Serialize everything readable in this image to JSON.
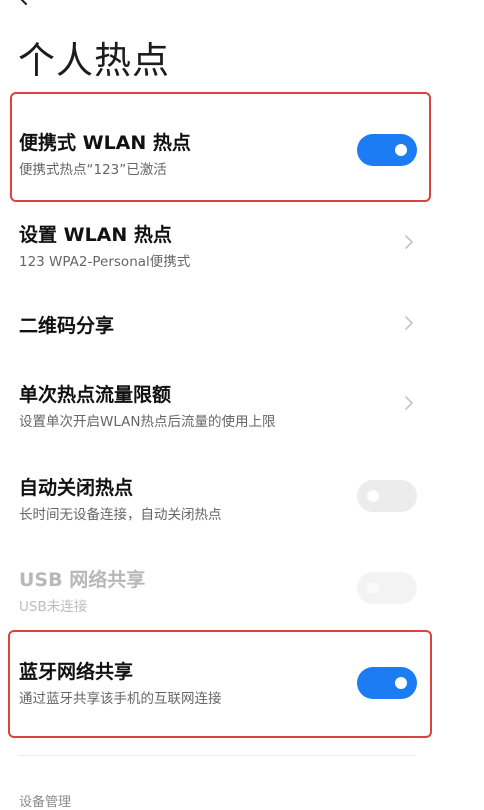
{
  "header": {
    "title": "个人热点",
    "back_icon": "back-arrow-icon"
  },
  "rows": [
    {
      "id": "portable-wlan",
      "title": "便携式 WLAN 热点",
      "subtitle": "便携式热点“123”已激活",
      "control": "toggle",
      "state": "on"
    },
    {
      "id": "setup-wlan",
      "title": "设置 WLAN 热点",
      "subtitle": "123 WPA2-Personal便携式",
      "control": "chevron"
    },
    {
      "id": "qr-share",
      "title": "二维码分享",
      "control": "chevron"
    },
    {
      "id": "data-limit",
      "title": "单次热点流量限额",
      "subtitle": "设置单次开启WLAN热点后流量的使用上限",
      "control": "chevron"
    },
    {
      "id": "auto-off",
      "title": "自动关闭热点",
      "subtitle": "长时间无设备连接，自动关闭热点",
      "control": "toggle",
      "state": "off"
    },
    {
      "id": "usb-tether",
      "title": "USB 网络共享",
      "subtitle": "USB未连接",
      "control": "toggle",
      "state": "off",
      "disabled": true
    },
    {
      "id": "bt-tether",
      "title": "蓝牙网络共享",
      "subtitle": "通过蓝牙共享该手机的互联网连接",
      "control": "toggle",
      "state": "on"
    }
  ],
  "section": {
    "device_management": "设备管理"
  },
  "colors": {
    "accent": "#1b7cf3",
    "highlight": "#d9453e",
    "toggle_off": "#ececec"
  }
}
